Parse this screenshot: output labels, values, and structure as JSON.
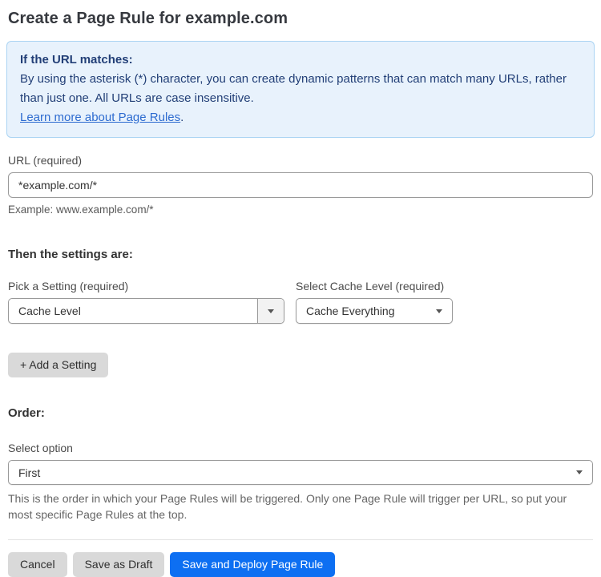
{
  "page": {
    "title": "Create a Page Rule for example.com"
  },
  "info_box": {
    "heading": "If the URL matches:",
    "body": "By using the asterisk (*) character, you can create dynamic patterns that can match many URLs, rather than just one. All URLs are case insensitive.",
    "link_label": "Learn more about Page Rules",
    "link_suffix": "."
  },
  "url_field": {
    "label": "URL (required)",
    "value": "*example.com/*",
    "example": "Example: www.example.com/*"
  },
  "settings": {
    "heading": "Then the settings are:",
    "setting_select": {
      "label": "Pick a Setting (required)",
      "value": "Cache Level"
    },
    "cache_level_select": {
      "label": "Select Cache Level (required)",
      "value": "Cache Everything"
    },
    "add_button_label": "+ Add a Setting"
  },
  "order": {
    "heading": "Order:",
    "select_label": "Select option",
    "value": "First",
    "help_text": "This is the order in which your Page Rules will be triggered. Only one Page Rule will trigger per URL, so put your most specific Page Rules at the top."
  },
  "actions": {
    "cancel_label": "Cancel",
    "save_draft_label": "Save as Draft",
    "save_deploy_label": "Save and Deploy Page Rule"
  },
  "colors": {
    "accent_blue": "#0d6ff2",
    "info_background": "#e8f2fc",
    "info_border": "#abd4f3",
    "info_text": "#223f77",
    "link_blue": "#2d6bd0",
    "button_gray": "#d9d9d9"
  }
}
